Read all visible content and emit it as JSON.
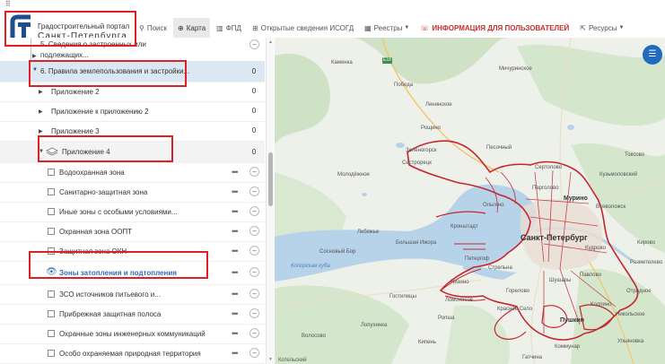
{
  "header": {
    "app_icon": "grid-icon",
    "logo": {
      "line1": "Градостроительный портал",
      "line2": "Санкт-Петербурга"
    },
    "nav": [
      {
        "id": "search",
        "icon": "search-icon",
        "glyph": "⚲",
        "label": "Поиск",
        "active": false
      },
      {
        "id": "map",
        "icon": "globe-icon",
        "glyph": "⊕",
        "label": "Карта",
        "active": true
      },
      {
        "id": "fpd",
        "icon": "map-icon",
        "glyph": "▥",
        "label": "ФПД",
        "active": false
      },
      {
        "id": "isogd",
        "icon": "plus-square-icon",
        "glyph": "⊞",
        "label": "Открытые сведения ИСОГД",
        "active": false
      },
      {
        "id": "registers",
        "icon": "table-icon",
        "glyph": "▦",
        "label": "Реестры",
        "active": false,
        "dropdown": true
      },
      {
        "id": "info",
        "icon": "chat-icon",
        "glyph": "☏",
        "label": "ИНФОРМАЦИЯ ДЛЯ ПОЛЬЗОВАТЕЛЕЙ",
        "active": false
      },
      {
        "id": "resources",
        "icon": "external-link-icon",
        "glyph": "⇱",
        "label": "Ресурсы",
        "active": false,
        "dropdown": true
      }
    ],
    "accent_color": "#c0312d"
  },
  "sidebar": {
    "rows": [
      {
        "label": "5. Сведения о застроенных или",
        "type": "cut"
      },
      {
        "label": "подлежащих...",
        "type": "cut"
      },
      {
        "label": "6. Правила землепользования и застройки...",
        "count": "0",
        "type": "group",
        "expanded": true
      },
      {
        "label": "Приложение 2",
        "count": "0",
        "type": "sub"
      },
      {
        "label": "Приложение к приложению 2",
        "count": "0",
        "type": "sub"
      },
      {
        "label": "Приложение 3",
        "count": "0",
        "type": "sub"
      },
      {
        "label": "Приложение 4",
        "count": "0",
        "type": "sub",
        "expanded": true
      },
      {
        "label": "Водоохранная зона",
        "type": "layer"
      },
      {
        "label": "Санитарно-защитная зона",
        "type": "layer"
      },
      {
        "label": "Иные зоны с особыми условиями...",
        "type": "layer"
      },
      {
        "label": "Охранная зона ООПТ",
        "type": "layer"
      },
      {
        "label": "Защитная зона ОКН",
        "type": "layer"
      },
      {
        "label": "Зоны затопления и подтопления",
        "type": "layer",
        "visible": true
      },
      {
        "label": "ЗСО источников питьевого и...",
        "type": "layer"
      },
      {
        "label": "Прибрежная защитная полоса",
        "type": "layer"
      },
      {
        "label": "Охранные зоны инженерных коммуникаций",
        "type": "layer"
      },
      {
        "label": "Особо охраняемая природная территория",
        "type": "layer"
      }
    ],
    "more_glyph": "•••",
    "minus_glyph": "–"
  },
  "map": {
    "labels": [
      {
        "text": "Каменка",
        "kind": "small"
      },
      {
        "text": "Победа",
        "kind": "small"
      },
      {
        "text": "Мичуринское",
        "kind": "small"
      },
      {
        "text": "Ленинское",
        "kind": "small"
      },
      {
        "text": "Рощино",
        "kind": "small"
      },
      {
        "text": "Токсово",
        "kind": "small"
      },
      {
        "text": "Зеленогорск",
        "kind": "small"
      },
      {
        "text": "Сестрорецк",
        "kind": "small"
      },
      {
        "text": "Сертолово",
        "kind": "small"
      },
      {
        "text": "Парголово",
        "kind": "small"
      },
      {
        "text": "Мурино",
        "kind": "big"
      },
      {
        "text": "Всеволожск",
        "kind": "small"
      },
      {
        "text": "Санкт-Петербург",
        "kind": "city"
      },
      {
        "text": "Кудрово",
        "kind": "small"
      },
      {
        "text": "Большая Ижора",
        "kind": "small"
      },
      {
        "text": "Сосновый Бор",
        "kind": "small"
      },
      {
        "text": "Копорская губа",
        "kind": "water"
      },
      {
        "text": "Кронштадт",
        "kind": "small"
      },
      {
        "text": "Петергоф",
        "kind": "small"
      },
      {
        "text": "Стрельна",
        "kind": "small"
      },
      {
        "text": "Шушары",
        "kind": "small"
      },
      {
        "text": "Красное Село",
        "kind": "small"
      },
      {
        "text": "Пушкин",
        "kind": "big"
      },
      {
        "text": "Колпино",
        "kind": "small"
      },
      {
        "text": "Отрадное",
        "kind": "small"
      },
      {
        "text": "Никольское",
        "kind": "small"
      },
      {
        "text": "Ульяновка",
        "kind": "small"
      },
      {
        "text": "Коммунар",
        "kind": "small"
      },
      {
        "text": "Гатчина",
        "kind": "small"
      },
      {
        "text": "Котельский",
        "kind": "small"
      },
      {
        "text": "Лопухинка",
        "kind": "small"
      },
      {
        "text": "Ропша",
        "kind": "small"
      },
      {
        "text": "Лебяжье",
        "kind": "small"
      },
      {
        "text": "Кипень",
        "kind": "small"
      },
      {
        "text": "Песочный",
        "kind": "small"
      },
      {
        "text": "Кузьмоловский",
        "kind": "small"
      },
      {
        "text": "Разметелево",
        "kind": "small"
      },
      {
        "text": "Павлово",
        "kind": "small"
      },
      {
        "text": "Низино",
        "kind": "small"
      },
      {
        "text": "Волосово",
        "kind": "small"
      },
      {
        "text": "Кирово",
        "kind": "small"
      },
      {
        "text": "Молодёжное",
        "kind": "small"
      },
      {
        "text": "Ломоносов",
        "kind": "small"
      },
      {
        "text": "Горелово",
        "kind": "small"
      },
      {
        "text": "Гостилицы",
        "kind": "small"
      },
      {
        "text": "Ольгино",
        "kind": "small"
      }
    ],
    "road_sign": "E18",
    "layers_button_icon": "layers-list-icon",
    "layers_button_glyph": "☰",
    "boundary_color": "#c4262e",
    "water_color": "#b7d3ea",
    "land_color": "#eef0ea"
  }
}
